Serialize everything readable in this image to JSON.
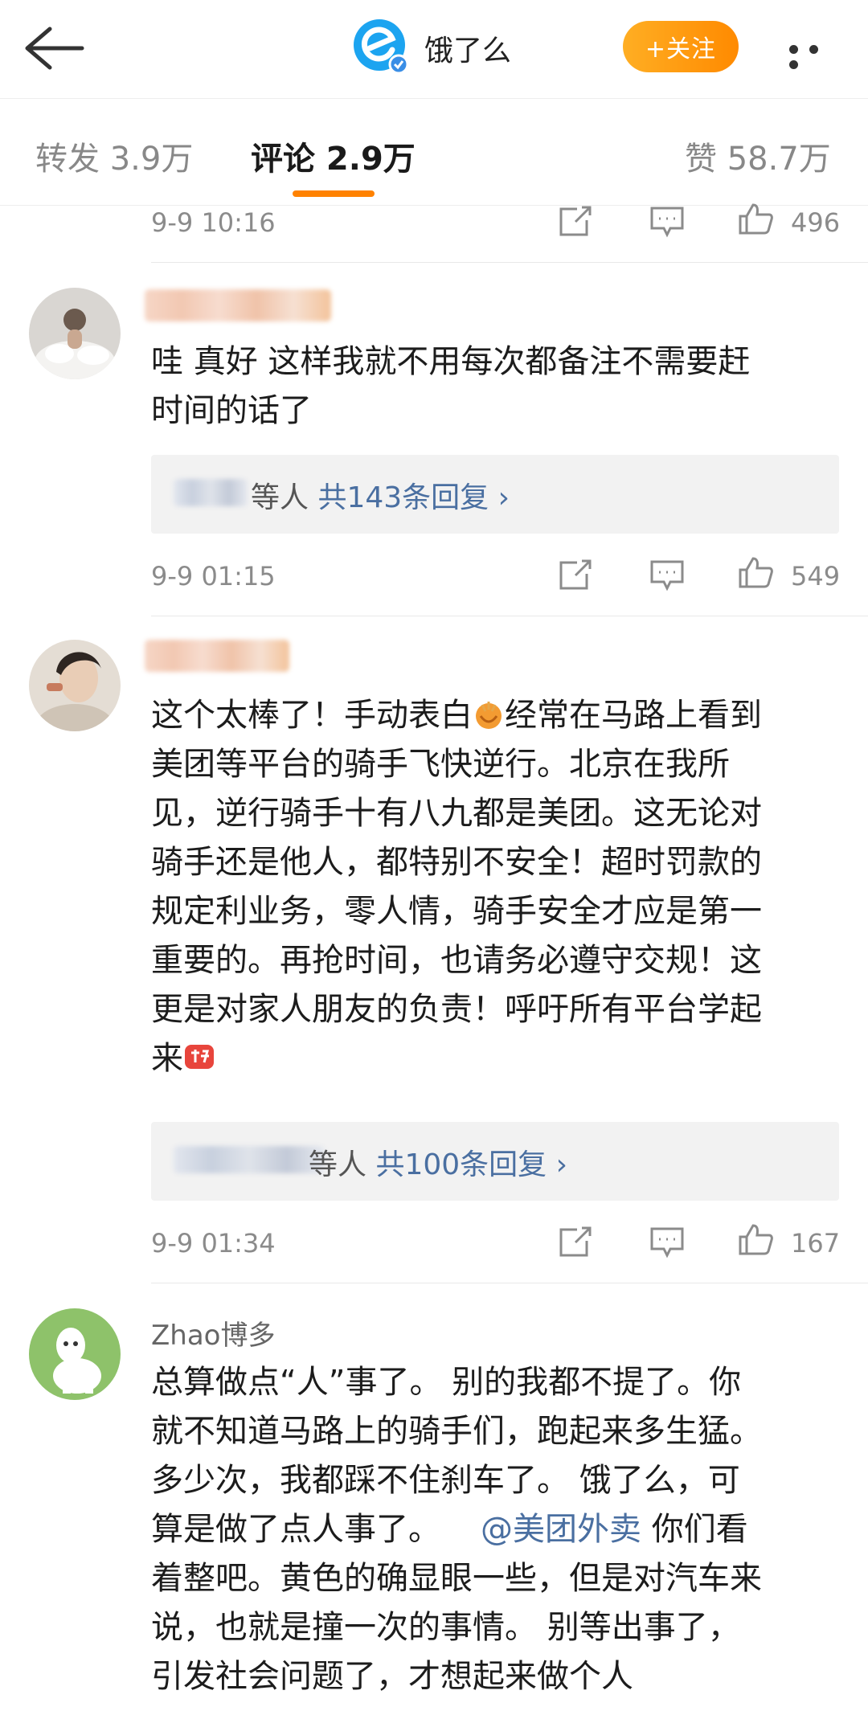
{
  "header": {
    "title": "饿了么",
    "follow_label": "+关注",
    "colors": {
      "accent": "#ff8200",
      "link": "#4a6fa1",
      "logo_blue": "#1ca4f0"
    }
  },
  "tabs": [
    {
      "label": "转发 3.9万"
    },
    {
      "label": "评论 2.9万"
    },
    {
      "label": "赞 58.7万"
    }
  ],
  "comments": [
    {
      "time": "9-9 10:16",
      "likes": "496"
    },
    {
      "text_lines": [
        "哇 真好  这样我就不用每次都备注不需要赶",
        "时间的话了"
      ],
      "reply_suffix": "等人",
      "reply_link": "共143条回复 ›",
      "time": "9-9 01:15",
      "likes": "549"
    },
    {
      "text_lines": [
        "这个太棒了！手动表白",
        "经常在马路上看到",
        "美团等平台的骑手飞快逆行。北京在我所",
        "见，逆行骑手十有八九都是美团。这无论对",
        "骑手还是他人，都特别不安全！超时罚款的",
        "规定利业务，零人情，骑手安全才应是第一",
        "重要的。再抢时间，也请务必遵守交规！这",
        "更是对家人朋友的负责！呼吁所有平台学起",
        "来"
      ],
      "reply_suffix": "等人",
      "reply_link": "共100条回复 ›",
      "time": "9-9 01:34",
      "likes": "167"
    },
    {
      "username": "Zhao博多",
      "text_lines": [
        "总算做点“人”事了。 别的我都不提了。你",
        "就不知道马路上的骑手们，跑起来多生猛。",
        "多少次，我都踩不住刹车了。   饿了么，可",
        "算是做了点人事了。",
        "@美团外卖",
        " 你们看",
        "着整吧。黄色的确显眼一些，但是对汽车来",
        "说，也就是撞一次的事情。 别等出事了，",
        "引发社会问题了，才想起来做个人"
      ]
    }
  ]
}
